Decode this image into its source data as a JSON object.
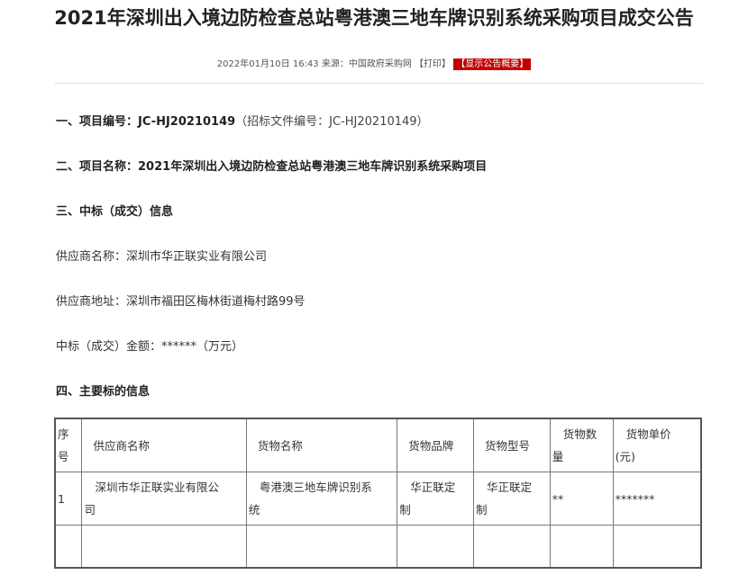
{
  "article": {
    "title": "2021年深圳出入境边防检查总站粤港澳三地车牌识别系统采购项目成交公告",
    "meta": {
      "date": "2022年01月10日 16:43",
      "source_label": "来源：",
      "source": "中国政府采购网",
      "print_label": "【打印】",
      "summary_label": "【显示公告概要】"
    },
    "sections": {
      "project_no_heading": "一、项目编号：",
      "project_no_value": "JC-HJ20210149",
      "project_no_note": "（招标文件编号：JC-HJ20210149）",
      "project_name_heading": "二、项目名称：",
      "project_name_value": "2021年深圳出入境边防检查总站粤港澳三地车牌识别系统采购项目",
      "award_heading": "三、中标（成交）信息",
      "supplier_name_line": "供应商名称：深圳市华正联实业有限公司",
      "supplier_address_line": "供应商地址：深圳市福田区梅林街道梅村路99号",
      "amount_line": "中标（成交）金额：******（万元）",
      "main_info_heading": "四、主要标的信息"
    },
    "table": {
      "headers": {
        "seq_1": "序",
        "seq_2": "号",
        "supplier": "供应商名称",
        "goods": "货物名称",
        "brand": "货物品牌",
        "model": "货物型号",
        "qty_1": "货物数",
        "qty_2": "量",
        "price_1": "货物单价",
        "price_2": "(元)"
      },
      "row": {
        "seq": "1",
        "supplier_1": "深圳市华正联实业有限公",
        "supplier_2": "司",
        "goods_1": "粤港澳三地车牌识别系",
        "goods_2": "统",
        "brand_1": "华正联定",
        "brand_2": "制",
        "model_1": "华正联定",
        "model_2": "制",
        "qty": "**",
        "price": "*******"
      }
    }
  }
}
